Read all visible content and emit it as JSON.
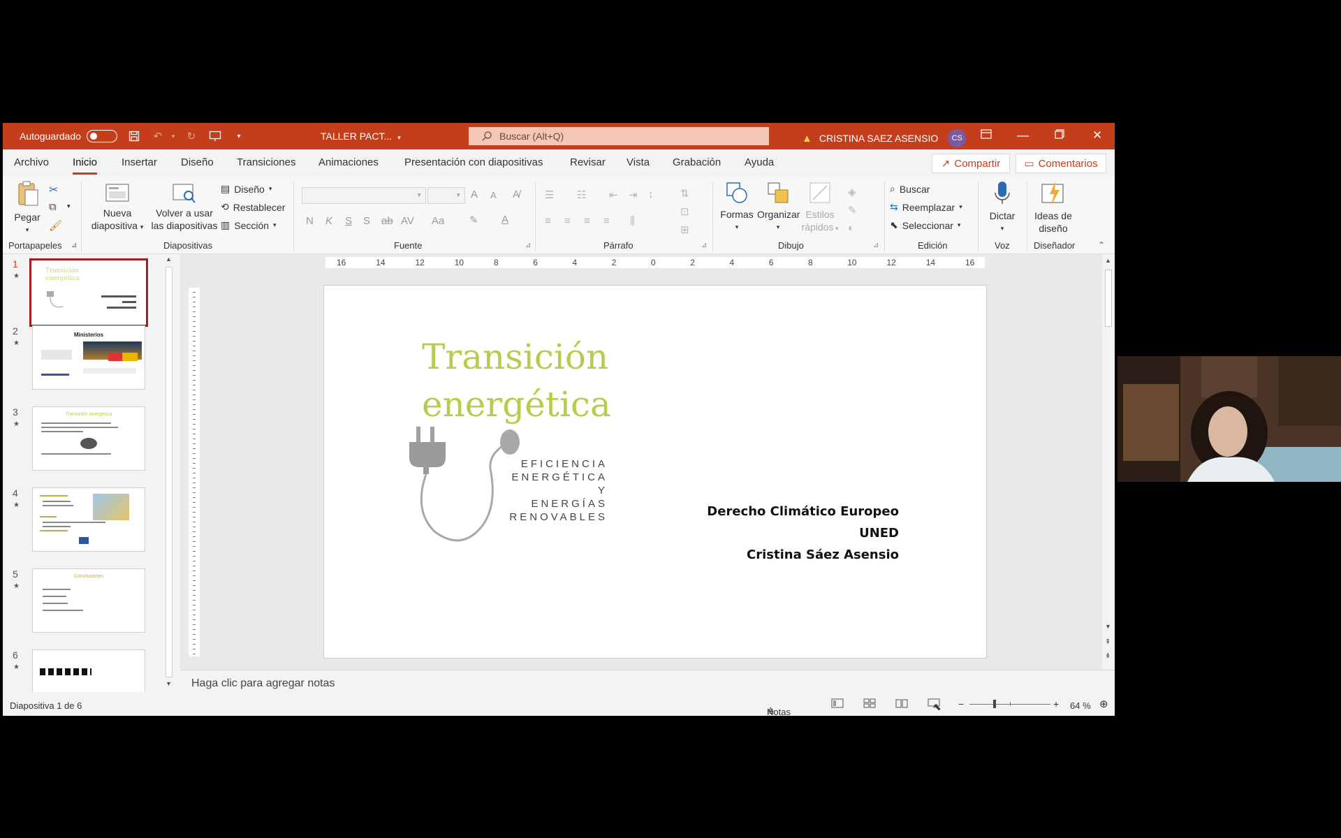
{
  "titlebar": {
    "autosave_label": "Autoguardado",
    "doc_title": "TALLER PACT...",
    "search_placeholder": "Buscar (Alt+Q)",
    "user_name": "CRISTINA SAEZ ASENSIO",
    "user_initials": "CS",
    "accent": "#c43e1c"
  },
  "menu": {
    "tabs": [
      "Archivo",
      "Inicio",
      "Insertar",
      "Diseño",
      "Transiciones",
      "Animaciones",
      "Presentación con diapositivas",
      "Revisar",
      "Vista",
      "Grabación",
      "Ayuda"
    ],
    "active_tab": "Inicio",
    "share_label": "Compartir",
    "comments_label": "Comentarios"
  },
  "ribbon": {
    "clipboard": {
      "paste": "Pegar",
      "group": "Portapapeles"
    },
    "slides": {
      "new_slide_1": "Nueva",
      "new_slide_2": "diapositiva",
      "reuse_1": "Volver a usar",
      "reuse_2": "las diapositivas",
      "layout": "Diseño",
      "reset": "Restablecer",
      "section": "Sección",
      "group": "Diapositivas"
    },
    "font": {
      "bold": "N",
      "italic": "K",
      "underline": "S",
      "shadow": "S",
      "strike": "ab",
      "spacing": "AV",
      "case": "Aa",
      "grow": "A",
      "shrink": "A",
      "group": "Fuente"
    },
    "paragraph": {
      "group": "Párrafo"
    },
    "drawing": {
      "shapes": "Formas",
      "arrange": "Organizar",
      "quick_styles_1": "Estilos",
      "quick_styles_2": "rápidos",
      "group": "Dibujo"
    },
    "editing": {
      "find": "Buscar",
      "replace": "Reemplazar",
      "select": "Seleccionar",
      "group": "Edición"
    },
    "voice": {
      "dictate": "Dictar",
      "group": "Voz"
    },
    "designer": {
      "ideas_1": "Ideas de",
      "ideas_2": "diseño",
      "group": "Diseñador"
    }
  },
  "thumbnails": [
    {
      "num": "1",
      "title": "Transición energética",
      "selected": true
    },
    {
      "num": "2",
      "title": "Ministerios",
      "selected": false
    },
    {
      "num": "3",
      "title": "Transición energética",
      "selected": false
    },
    {
      "num": "4",
      "title": "",
      "selected": false
    },
    {
      "num": "5",
      "title": "Conclusiones",
      "selected": false
    },
    {
      "num": "6",
      "title": "",
      "selected": false
    }
  ],
  "ruler": {
    "h_ticks": [
      "16",
      "14",
      "12",
      "10",
      "8",
      "6",
      "4",
      "2",
      "0",
      "2",
      "4",
      "6",
      "8",
      "10",
      "12",
      "14",
      "16"
    ]
  },
  "slide": {
    "title_line1": "Transición",
    "title_line2": "energética",
    "tagline_1": "EFICIENCIA",
    "tagline_2": "ENERGÉTICA Y",
    "tagline_3": "ENERGÍAS",
    "tagline_4": "RENOVABLES",
    "author_1": "Derecho Climático Europeo",
    "author_2": "UNED",
    "author_3": "Cristina Sáez Asensio",
    "title_color": "#b7cb4e"
  },
  "notes": {
    "placeholder": "Haga clic para agregar notas"
  },
  "status": {
    "slide_counter": "Diapositiva 1 de 6",
    "notes_label": "Notas",
    "zoom": "64 %"
  }
}
